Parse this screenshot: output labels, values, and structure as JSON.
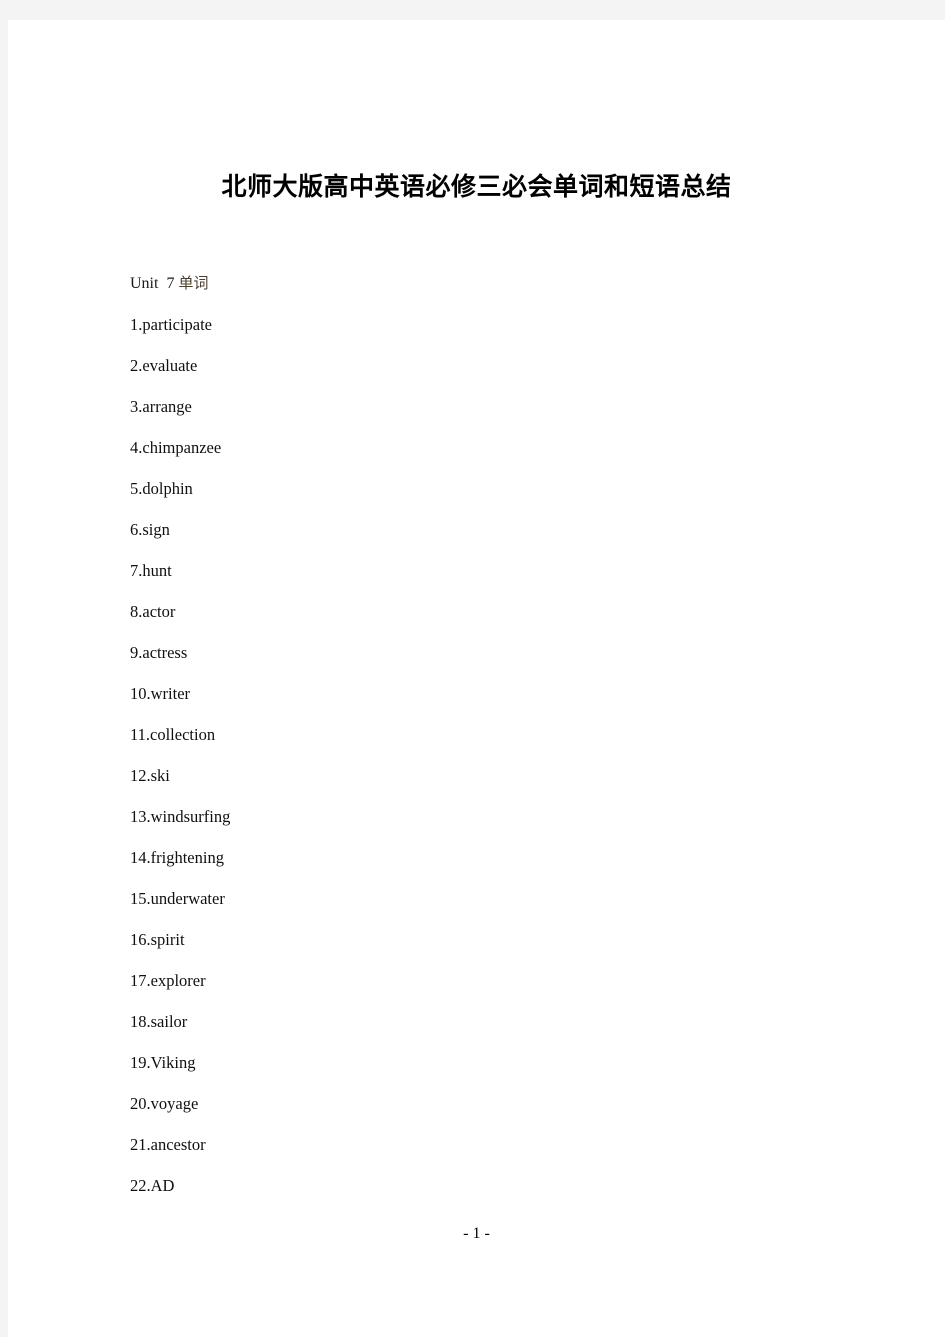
{
  "document": {
    "title": "北师大版高中英语必修三必会单词和短语总结",
    "section": {
      "unit_label": "Unit",
      "unit_number": "7",
      "section_type": "单词",
      "heading_full": "Unit  7 单词"
    },
    "words": [
      {
        "number": "1.",
        "term": "participate"
      },
      {
        "number": "2.",
        "term": "evaluate"
      },
      {
        "number": "3.",
        "term": "arrange"
      },
      {
        "number": "4.",
        "term": "chimpanzee"
      },
      {
        "number": "5.",
        "term": "dolphin"
      },
      {
        "number": "6.",
        "term": "sign"
      },
      {
        "number": "7.",
        "term": "hunt"
      },
      {
        "number": "8.",
        "term": "actor"
      },
      {
        "number": "9.",
        "term": "actress"
      },
      {
        "number": "10.",
        "term": "writer"
      },
      {
        "number": "11.",
        "term": "collection"
      },
      {
        "number": "12.",
        "term": "ski"
      },
      {
        "number": "13.",
        "term": "windsurfing"
      },
      {
        "number": "14.",
        "term": "frightening"
      },
      {
        "number": "15.",
        "term": "underwater"
      },
      {
        "number": "16.",
        "term": "spirit"
      },
      {
        "number": "17.",
        "term": "explorer"
      },
      {
        "number": "18.",
        "term": "sailor"
      },
      {
        "number": "19.",
        "term": "Viking"
      },
      {
        "number": "20.",
        "term": "voyage"
      },
      {
        "number": "21.",
        "term": "ancestor"
      },
      {
        "number": "22.",
        "term": "AD"
      }
    ],
    "footer": {
      "page_marker": "- 1 -"
    },
    "colors": {
      "page_background": "#ffffff",
      "surround": "#f4f4f4",
      "body_text": "#101010",
      "cjk_accent": "#4a4030"
    }
  }
}
